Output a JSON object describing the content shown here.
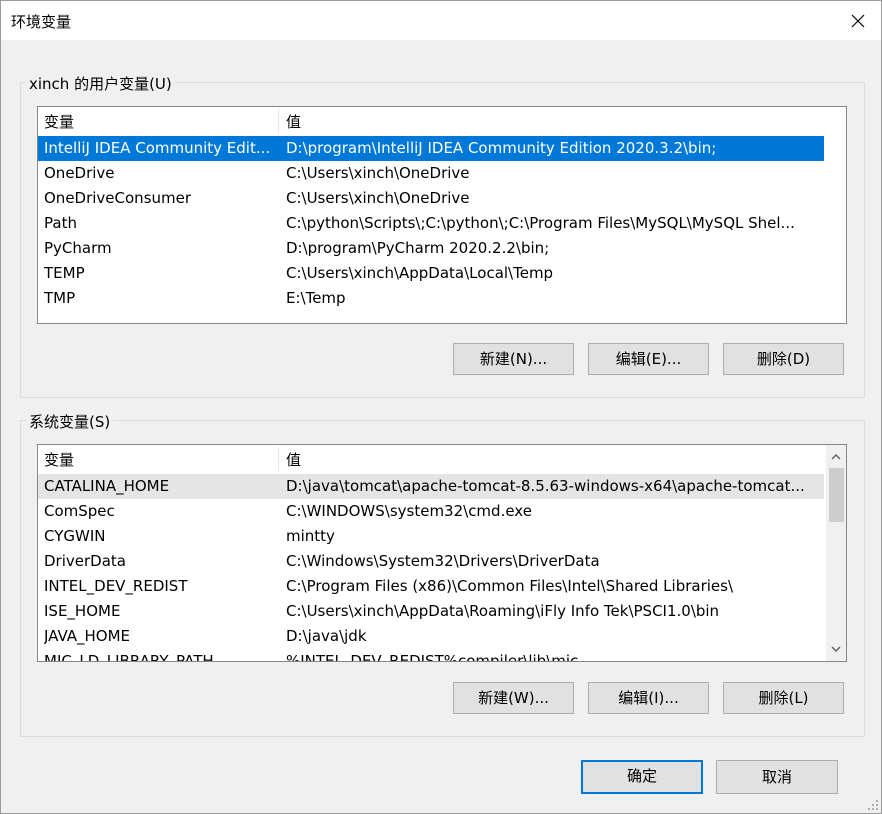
{
  "window": {
    "title": "环境变量"
  },
  "user_vars": {
    "label": "xinch 的用户变量(U)",
    "columns": [
      "变量",
      "值"
    ],
    "rows": [
      {
        "name": "IntelliJ IDEA Community Edit...",
        "value": "D:\\program\\IntelliJ IDEA Community Edition 2020.3.2\\bin;"
      },
      {
        "name": "OneDrive",
        "value": "C:\\Users\\xinch\\OneDrive"
      },
      {
        "name": "OneDriveConsumer",
        "value": "C:\\Users\\xinch\\OneDrive"
      },
      {
        "name": "Path",
        "value": "C:\\python\\Scripts\\;C:\\python\\;C:\\Program Files\\MySQL\\MySQL Shel..."
      },
      {
        "name": "PyCharm",
        "value": "D:\\program\\PyCharm 2020.2.2\\bin;"
      },
      {
        "name": "TEMP",
        "value": "C:\\Users\\xinch\\AppData\\Local\\Temp"
      },
      {
        "name": "TMP",
        "value": "E:\\Temp"
      }
    ],
    "buttons": {
      "new": "新建(N)...",
      "edit": "编辑(E)...",
      "delete": "删除(D)"
    }
  },
  "system_vars": {
    "label": "系统变量(S)",
    "columns": [
      "变量",
      "值"
    ],
    "rows": [
      {
        "name": "CATALINA_HOME",
        "value": "D:\\java\\tomcat\\apache-tomcat-8.5.63-windows-x64\\apache-tomcat..."
      },
      {
        "name": "ComSpec",
        "value": "C:\\WINDOWS\\system32\\cmd.exe"
      },
      {
        "name": "CYGWIN",
        "value": "mintty"
      },
      {
        "name": "DriverData",
        "value": "C:\\Windows\\System32\\Drivers\\DriverData"
      },
      {
        "name": "INTEL_DEV_REDIST",
        "value": "C:\\Program Files (x86)\\Common Files\\Intel\\Shared Libraries\\"
      },
      {
        "name": "ISE_HOME",
        "value": "C:\\Users\\xinch\\AppData\\Roaming\\iFly Info Tek\\PSCI1.0\\bin"
      },
      {
        "name": "JAVA_HOME",
        "value": "D:\\java\\jdk"
      },
      {
        "name": "MIC_LD_LIBRARY_PATH",
        "value": "%INTEL_DEV_REDIST%compiler\\lib\\mic"
      }
    ],
    "buttons": {
      "new": "新建(W)...",
      "edit": "编辑(I)...",
      "delete": "删除(L)"
    }
  },
  "footer": {
    "ok": "确定",
    "cancel": "取消"
  },
  "icons": {
    "close": "close-icon",
    "scroll_up": "chevron-up-icon",
    "scroll_down": "chevron-down-icon",
    "grip": "resize-grip-icon"
  },
  "colors": {
    "selection": "#0078d7",
    "hover": "#e5e5e5",
    "default_button_border": "#0078d7"
  }
}
